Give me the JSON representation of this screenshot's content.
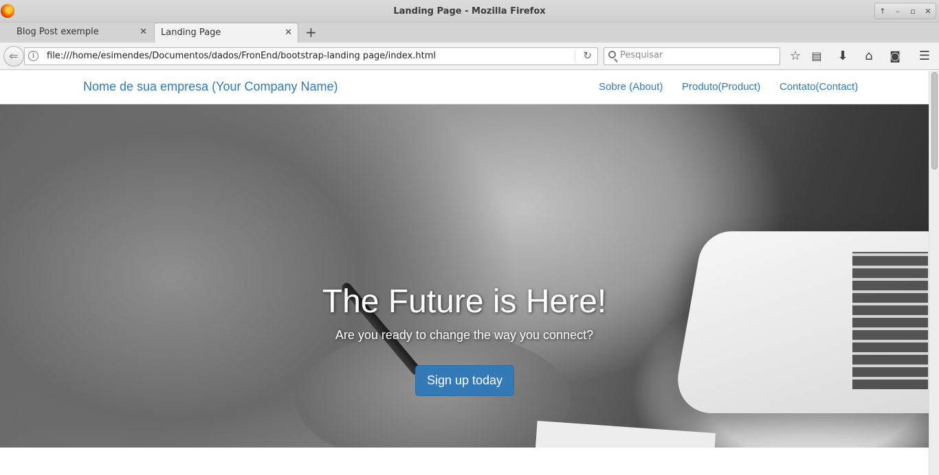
{
  "window": {
    "title": "Landing Page - Mozilla Firefox",
    "controls": [
      "↑",
      "–",
      "▫",
      "✕"
    ]
  },
  "tabs": [
    {
      "label": "Blog Post exemple",
      "active": false
    },
    {
      "label": "Landing Page",
      "active": true
    }
  ],
  "navbar": {
    "url": "file:///home/esimendes/Documentos/dados/FronEnd/bootstrap-landing page/index.html",
    "search_placeholder": "Pesquisar"
  },
  "site": {
    "brand": "Nome de sua empresa (Your Company Name)",
    "nav_links": [
      "Sobre (About)",
      "Produto(Product)",
      "Contato(Contact)"
    ],
    "hero": {
      "title": "The Future is Here!",
      "subtitle": "Are you ready to change the way you connect?",
      "cta": "Sign up today"
    },
    "link_color": "#337ab7"
  }
}
